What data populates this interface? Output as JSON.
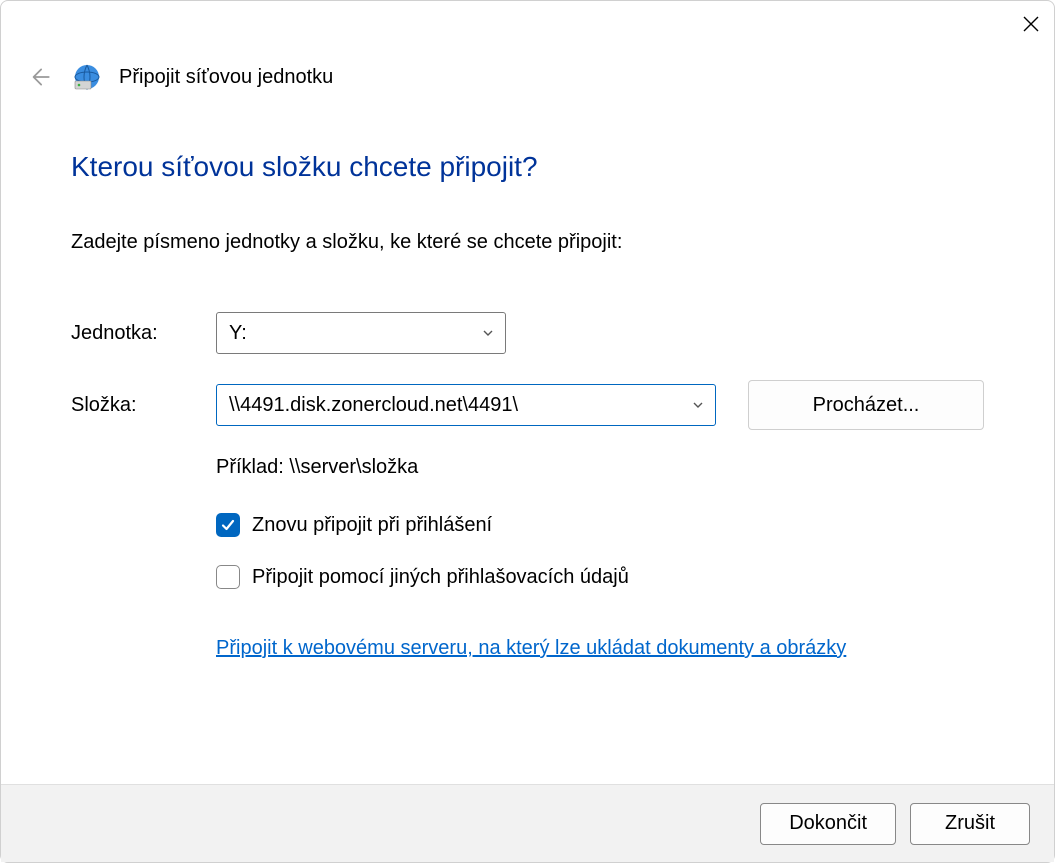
{
  "window": {
    "title": "Připojit síťovou jednotku"
  },
  "heading": "Kterou síťovou složku chcete připojit?",
  "subtext": "Zadejte písmeno jednotky a složku, ke které se chcete připojit:",
  "labels": {
    "drive": "Jednotka:",
    "folder": "Složka:"
  },
  "drive": {
    "selected": "Y:"
  },
  "folder": {
    "value": "\\\\4491.disk.zonercloud.net\\4491\\",
    "example": "Příklad: \\\\server\\složka"
  },
  "buttons": {
    "browse": "Procházet...",
    "finish": "Dokončit",
    "cancel": "Zrušit"
  },
  "checkboxes": {
    "reconnect": {
      "label": "Znovu připojit při přihlášení",
      "checked": true
    },
    "credentials": {
      "label": "Připojit pomocí jiných přihlašovacích údajů",
      "checked": false
    }
  },
  "link": "Připojit k webovému serveru, na který lze ukládat dokumenty a obrázky"
}
